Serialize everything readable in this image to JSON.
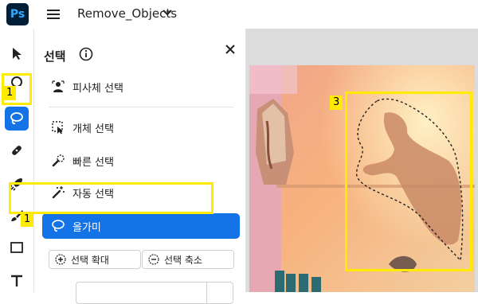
{
  "app": {
    "logo_text": "Ps",
    "document_title": "Remove_Objects"
  },
  "panel": {
    "title": "선택",
    "items": [
      {
        "label": "피사체 선택",
        "icon": "subject-select-icon"
      },
      {
        "label": "개체 선택",
        "icon": "object-select-icon"
      },
      {
        "label": "빠른 선택",
        "icon": "quick-select-icon"
      },
      {
        "label": "자동 선택",
        "icon": "magic-wand-icon"
      },
      {
        "label": "올가미",
        "icon": "lasso-icon",
        "selected": true
      }
    ],
    "buttons": [
      {
        "label": "선택 확대",
        "icon": "expand-selection-icon"
      },
      {
        "label": "선택 축소",
        "icon": "contract-selection-icon"
      }
    ]
  },
  "annotations": {
    "tool_marker": "1",
    "menu_marker": "1",
    "canvas_marker": "3"
  },
  "colors": {
    "accent": "#1473e6",
    "highlight": "#ffeb00",
    "brand_bg": "#001e36",
    "brand_fg": "#31a8ff"
  }
}
